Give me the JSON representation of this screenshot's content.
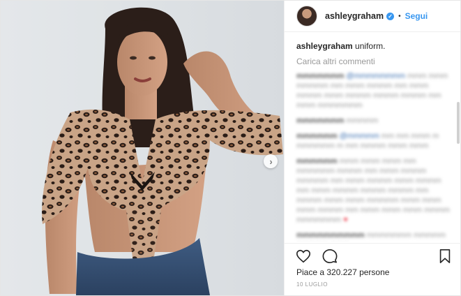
{
  "post": {
    "username": "ashleygraham",
    "separator": "•",
    "follow_label": "Segui",
    "verified_glyph": "✓",
    "caption_user": "ashleygraham",
    "caption_text": " uniform.",
    "load_more": "Carica altri commenti",
    "likes": "Piace a 320.227 persone",
    "date": "10 LUGLIO"
  },
  "icons": {
    "heart": "heart-icon",
    "comment": "comment-icon",
    "bookmark": "bookmark-icon",
    "next": "chevron-right-icon"
  },
  "colors": {
    "link_blue": "#3897f0",
    "text": "#262626",
    "muted": "#999999"
  }
}
